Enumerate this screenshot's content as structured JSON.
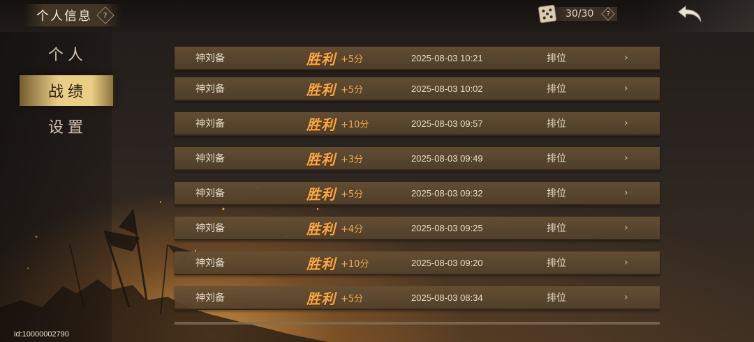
{
  "header": {
    "title": "个人信息",
    "help_glyph": "?",
    "stamina_icon": "dice-icon",
    "stamina_value": "30/30",
    "stamina_help_glyph": "?",
    "back_icon": "back-arrow-icon"
  },
  "sidebar": {
    "items": [
      {
        "label": "个人",
        "active": false
      },
      {
        "label": "战绩",
        "active": true
      },
      {
        "label": "设置",
        "active": false
      }
    ]
  },
  "records": [
    {
      "name": "神刘备",
      "result": "胜利",
      "score": "+5分",
      "time": "2025-08-03 10:21",
      "mode": "排位",
      "arrow": "›"
    },
    {
      "name": "神刘备",
      "result": "胜利",
      "score": "+5分",
      "time": "2025-08-03 10:02",
      "mode": "排位",
      "arrow": "›"
    },
    {
      "name": "神刘备",
      "result": "胜利",
      "score": "+10分",
      "time": "2025-08-03 09:57",
      "mode": "排位",
      "arrow": "›"
    },
    {
      "name": "神刘备",
      "result": "胜利",
      "score": "+3分",
      "time": "2025-08-03 09:49",
      "mode": "排位",
      "arrow": "›"
    },
    {
      "name": "神刘备",
      "result": "胜利",
      "score": "+5分",
      "time": "2025-08-03 09:32",
      "mode": "排位",
      "arrow": "›"
    },
    {
      "name": "神刘备",
      "result": "胜利",
      "score": "+4分",
      "time": "2025-08-03 09:25",
      "mode": "排位",
      "arrow": "›"
    },
    {
      "name": "神刘备",
      "result": "胜利",
      "score": "+10分",
      "time": "2025-08-03 09:20",
      "mode": "排位",
      "arrow": "›"
    },
    {
      "name": "神刘备",
      "result": "胜利",
      "score": "+5分",
      "time": "2025-08-03 08:34",
      "mode": "排位",
      "arrow": "›"
    }
  ],
  "footer": {
    "user_id": "id:10000002790"
  },
  "colors": {
    "win_text": "#f2a94e",
    "score_text": "#f0a955",
    "row_bg": "#66503a",
    "sidebar_active": "#f5d78c"
  }
}
